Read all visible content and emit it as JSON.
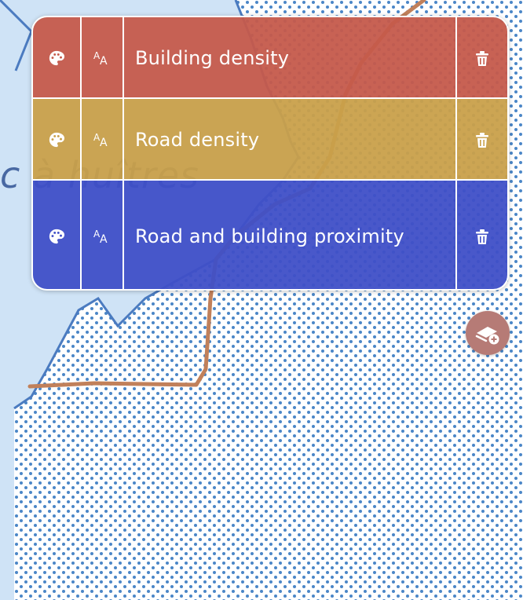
{
  "map": {
    "place_label": "c à huîtres"
  },
  "layers": [
    {
      "name": "Building density",
      "color": "#c55a4b"
    },
    {
      "name": "Road density",
      "color": "#c9a04a"
    },
    {
      "name": "Road and building proximity",
      "color": "#3f4fc7"
    }
  ],
  "icons": {
    "style": "palette-icon",
    "label": "font-size-icon",
    "delete": "trash-icon",
    "add_layer": "add-layer-icon"
  }
}
